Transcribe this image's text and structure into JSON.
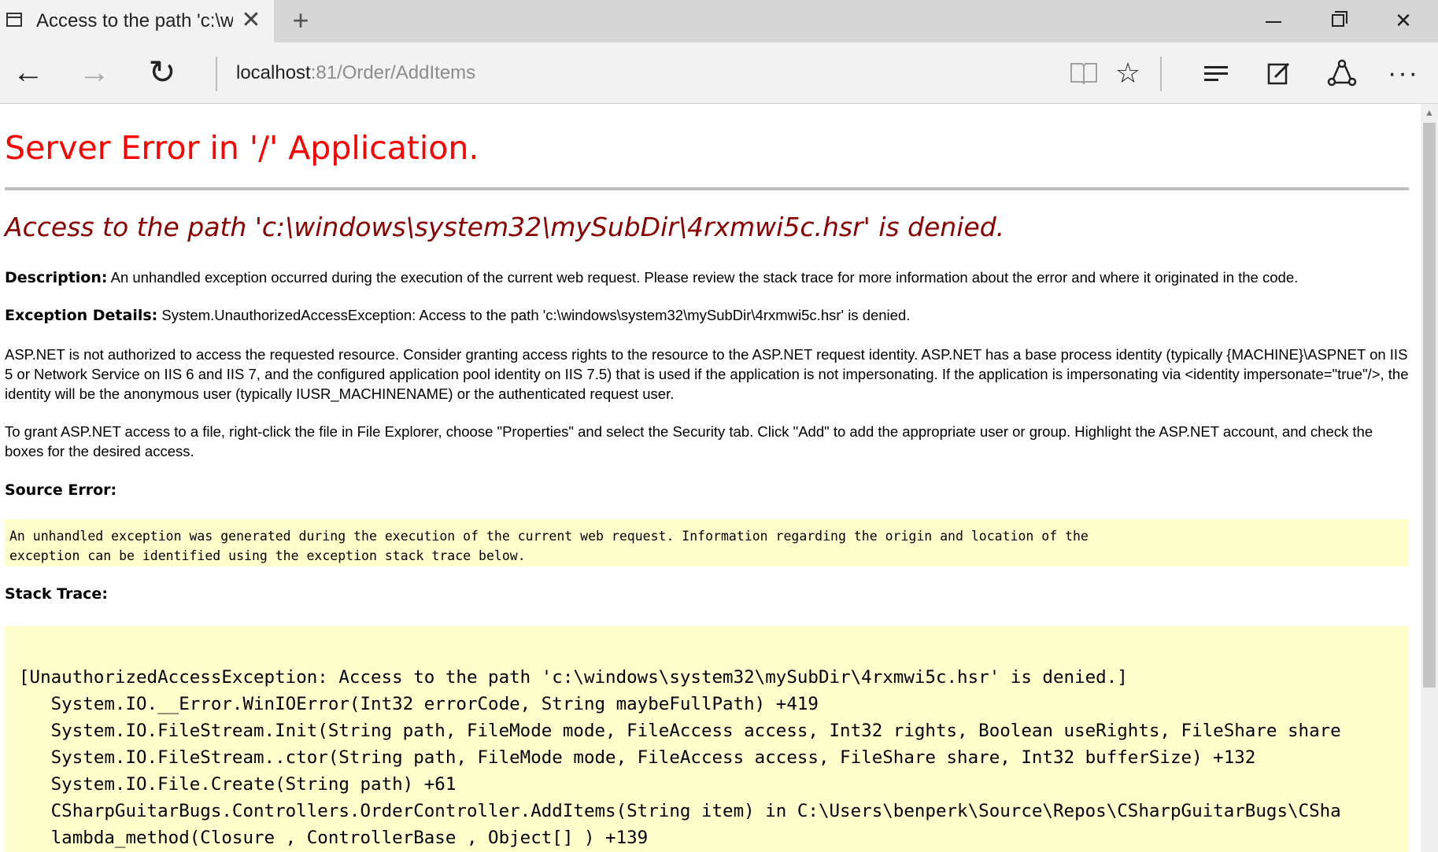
{
  "browser": {
    "tab_title": "Access to the path 'c:\\wi",
    "tab_close": "✕",
    "new_tab": "+",
    "address_host": "localhost",
    "address_rest": ":81/Order/AddItems",
    "window_minimize": "",
    "window_maximize": "",
    "window_close": "✕",
    "icons": {
      "back": "←",
      "forward": "→",
      "refresh": "↻",
      "reading_view": "📖",
      "favorite": "☆",
      "note": "✎",
      "share": "⇪",
      "more": "···"
    }
  },
  "page": {
    "title": "Server Error in '/' Application.",
    "error_message": "Access to the path 'c:\\windows\\system32\\mySubDir\\4rxmwi5c.hsr' is denied.",
    "description_label": "Description:",
    "description_text": " An unhandled exception occurred during the execution of the current web request. Please review the stack trace for more information about the error and where it originated in the code.",
    "exception_label": "Exception Details:",
    "exception_text": " System.UnauthorizedAccessException: Access to the path 'c:\\windows\\system32\\mySubDir\\4rxmwi5c.hsr' is denied.",
    "paragraph1": "ASP.NET is not authorized to access the requested resource. Consider granting access rights to the resource to the ASP.NET request identity. ASP.NET has a base process identity (typically {MACHINE}\\ASPNET on IIS 5 or Network Service on IIS 6 and IIS 7, and the configured application pool identity on IIS 7.5) that is used if the application is not impersonating. If the application is impersonating via <identity impersonate=\"true\"/>, the identity will be the anonymous user (typically IUSR_MACHINENAME) or the authenticated request user.",
    "paragraph2": "To grant ASP.NET access to a file, right-click the file in File Explorer, choose \"Properties\" and select the Security tab. Click \"Add\" to add the appropriate user or group. Highlight the ASP.NET account, and check the boxes for the desired access.",
    "source_error_label": "Source Error:",
    "source_error_lines": [
      "An unhandled exception was generated during the execution of the current web request. Information regarding the origin and location of the",
      "exception can be identified using the exception stack trace below."
    ],
    "stack_trace_label": "Stack Trace:",
    "stack_trace_lines": [
      "[UnauthorizedAccessException: Access to the path 'c:\\windows\\system32\\mySubDir\\4rxmwi5c.hsr' is denied.]",
      "   System.IO.__Error.WinIOError(Int32 errorCode, String maybeFullPath) +419",
      "   System.IO.FileStream.Init(String path, FileMode mode, FileAccess access, Int32 rights, Boolean useRights, FileShare share",
      "   System.IO.FileStream..ctor(String path, FileMode mode, FileAccess access, FileShare share, Int32 bufferSize) +132",
      "   System.IO.File.Create(String path) +61",
      "   CSharpGuitarBugs.Controllers.OrderController.AddItems(String item) in C:\\Users\\benperk\\Source\\Repos\\CSharpGuitarBugs\\CSha",
      "   lambda_method(Closure , ControllerBase , Object[] ) +139"
    ]
  },
  "colors": {
    "title_red": "#ff0000",
    "error_darkred": "#8b0000",
    "code_background": "#ffffcc"
  }
}
